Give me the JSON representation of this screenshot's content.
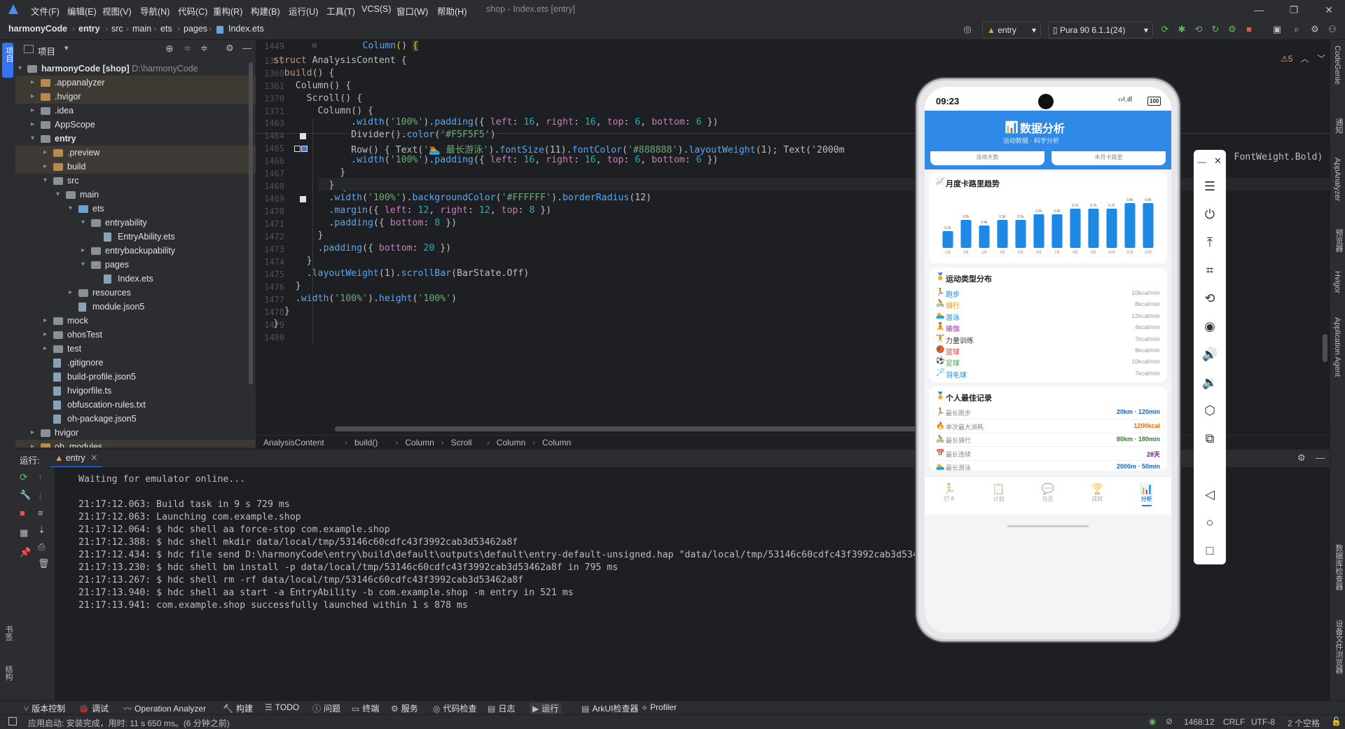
{
  "menu": [
    "文件(F)",
    "编辑(E)",
    "视图(V)",
    "导航(N)",
    "代码(C)",
    "重构(R)",
    "构建(B)",
    "运行(U)",
    "工具(T)",
    "VCS(S)",
    "窗口(W)",
    "帮助(H)"
  ],
  "window_title": "shop - Index.ets [entry]",
  "breadcrumbs": [
    "harmonyCode",
    "entry",
    "src",
    "main",
    "ets",
    "pages",
    "Index.ets"
  ],
  "toolbar": {
    "run_config": "entry",
    "device": "Pura 90 6.1.1(24)"
  },
  "project_panel": {
    "title": "项目",
    "root": {
      "name": "harmonyCode [shop]",
      "path": "D:\\harmonyCode"
    },
    "items": [
      {
        "name": ".appanalyzer",
        "indent": 1,
        "arrow": "▸",
        "icon": "folder-orange",
        "sel": true
      },
      {
        "name": ".hvigor",
        "indent": 1,
        "arrow": "▸",
        "icon": "folder-orange",
        "sel": true
      },
      {
        "name": ".idea",
        "indent": 1,
        "arrow": "▸",
        "icon": "folder"
      },
      {
        "name": "AppScope",
        "indent": 1,
        "arrow": "▸",
        "icon": "folder"
      },
      {
        "name": "entry",
        "indent": 1,
        "arrow": "▾",
        "icon": "folder",
        "bold": true
      },
      {
        "name": ".preview",
        "indent": 2,
        "arrow": "▸",
        "icon": "folder-orange",
        "sel": true
      },
      {
        "name": "build",
        "indent": 2,
        "arrow": "▸",
        "icon": "folder-orange",
        "sel": true
      },
      {
        "name": "src",
        "indent": 2,
        "arrow": "▾",
        "icon": "folder"
      },
      {
        "name": "main",
        "indent": 3,
        "arrow": "▾",
        "icon": "folder"
      },
      {
        "name": "ets",
        "indent": 4,
        "arrow": "▾",
        "icon": "folder-blue"
      },
      {
        "name": "entryability",
        "indent": 5,
        "arrow": "▾",
        "icon": "folder"
      },
      {
        "name": "EntryAbility.ets",
        "indent": 6,
        "arrow": "",
        "icon": "file"
      },
      {
        "name": "entrybackupability",
        "indent": 5,
        "arrow": "▸",
        "icon": "folder"
      },
      {
        "name": "pages",
        "indent": 5,
        "arrow": "▾",
        "icon": "folder"
      },
      {
        "name": "Index.ets",
        "indent": 6,
        "arrow": "",
        "icon": "file"
      },
      {
        "name": "resources",
        "indent": 4,
        "arrow": "▸",
        "icon": "folder"
      },
      {
        "name": "module.json5",
        "indent": 4,
        "arrow": "",
        "icon": "file"
      },
      {
        "name": "mock",
        "indent": 2,
        "arrow": "▸",
        "icon": "folder"
      },
      {
        "name": "ohosTest",
        "indent": 2,
        "arrow": "▸",
        "icon": "folder"
      },
      {
        "name": "test",
        "indent": 2,
        "arrow": "▸",
        "icon": "folder"
      },
      {
        "name": ".gitignore",
        "indent": 2,
        "arrow": "",
        "icon": "file"
      },
      {
        "name": "build-profile.json5",
        "indent": 2,
        "arrow": "",
        "icon": "file"
      },
      {
        "name": "hvigorfile.ts",
        "indent": 2,
        "arrow": "",
        "icon": "file"
      },
      {
        "name": "obfuscation-rules.txt",
        "indent": 2,
        "arrow": "",
        "icon": "file"
      },
      {
        "name": "oh-package.json5",
        "indent": 2,
        "arrow": "",
        "icon": "file"
      },
      {
        "name": "hvigor",
        "indent": 1,
        "arrow": "▸",
        "icon": "folder"
      },
      {
        "name": "oh_modules",
        "indent": 1,
        "arrow": "▸",
        "icon": "folder-orange",
        "sel": true
      }
    ]
  },
  "editor": {
    "sticky": [
      {
        "n": "1449",
        "t": "Column() {"
      },
      {
        "n": "1359",
        "t": "struct AnalysisContent {"
      },
      {
        "n": "1360",
        "t": "  build() {"
      },
      {
        "n": "1361",
        "t": "    Column() {"
      },
      {
        "n": "1370",
        "t": "      Scroll() {"
      },
      {
        "n": "1371",
        "t": "        Column() {"
      }
    ],
    "lines": [
      {
        "n": "1463",
        "t": "              .width('100%').padding({ left: 16, right: 16, top: 6, bottom: 6 })"
      },
      {
        "n": "1464",
        "t": "              Divider().color('#F5F5F5')"
      },
      {
        "n": "1465",
        "t": "              Row() { Text('🏊 最长游泳').fontSize(11).fontColor('#888888').layoutWeight(1); Text('2000m"
      },
      {
        "n": "1466",
        "t": "              .width('100%').padding({ left: 16, right: 16, top: 6, bottom: 6 })"
      },
      {
        "n": "1467",
        "t": "            }"
      },
      {
        "n": "1468",
        "t": "          }"
      },
      {
        "n": "1469",
        "t": "          .width('100%').backgroundColor('#FFFFFF').borderRadius(12)"
      },
      {
        "n": "1470",
        "t": "          .margin({ left: 12, right: 12, top: 8 })"
      },
      {
        "n": "1471",
        "t": "          .padding({ bottom: 8 })"
      },
      {
        "n": "1472",
        "t": "        }"
      },
      {
        "n": "1473",
        "t": "        .padding({ bottom: 20 })"
      },
      {
        "n": "1474",
        "t": "      }"
      },
      {
        "n": "1475",
        "t": "      .layoutWeight(1).scrollBar(BarState.Off)"
      },
      {
        "n": "1476",
        "t": "    }"
      },
      {
        "n": "1477",
        "t": "    .width('100%').height('100%')"
      },
      {
        "n": "1478",
        "t": "  }"
      },
      {
        "n": "1479",
        "t": "}"
      },
      {
        "n": "1480",
        "t": ""
      }
    ],
    "overflow_right": "tW    FontWeight.Bold) }",
    "warnings": "⚠5",
    "crumbs": [
      "AnalysisContent",
      "build()",
      "Column",
      "Scroll",
      "Column",
      "Column"
    ]
  },
  "run": {
    "label": "运行:",
    "tab": "entry",
    "log": [
      "Waiting for emulator online...",
      "",
      "21:17:12.063: Build task in 9 s 729 ms",
      "21:17:12.063: Launching com.example.shop",
      "21:17:12.064: $ hdc shell aa force-stop com.example.shop",
      "21:17:12.388: $ hdc shell mkdir data/local/tmp/53146c60cdfc43f3992cab3d53462a8f",
      "21:17:12.434: $ hdc file send D:\\harmonyCode\\entry\\build\\default\\outputs\\default\\entry-default-unsigned.hap \"data/local/tmp/53146c60cdfc43f3992cab3d5346",
      "21:17:13.230: $ hdc shell bm install -p data/local/tmp/53146c60cdfc43f3992cab3d53462a8f in 795 ms",
      "21:17:13.267: $ hdc shell rm -rf data/local/tmp/53146c60cdfc43f3992cab3d53462a8f",
      "21:17:13.940: $ hdc shell aa start -a EntryAbility -b com.example.shop -m entry in 521 ms",
      "21:17:13.941: com.example.shop successfully launched within 1 s 878 ms"
    ]
  },
  "bottom_tools": [
    "版本控制",
    "调试",
    "Operation Analyzer",
    "构建",
    "TODO",
    "问题",
    "终端",
    "服务",
    "代码检查",
    "日志",
    "运行",
    "ArkUI检查器",
    "Profiler"
  ],
  "status": {
    "message": "应用启动: 安装完成，用时: 11 s 650 ms。(6 分钟之前)",
    "position": "1468:12",
    "line_sep": "CRLF",
    "encoding": "UTF-8",
    "indent": "2 个空格"
  },
  "right_stripe": [
    "CodeGenie",
    "通知",
    "AppAnalyzer",
    "预览器",
    "Hvigor",
    "Application Agent",
    "数据库检查器",
    "设备文件浏览器"
  ],
  "left_stripe": [
    "项目",
    "书签",
    "结构"
  ],
  "phone": {
    "time": "09:23",
    "battery": "100",
    "header": {
      "title": "数据分析",
      "subtitle": "运动数据 · 科学分析"
    },
    "stat_labels": [
      "连续天数",
      "本月卡路里"
    ],
    "trend": {
      "title": "月度卡路里趋势"
    },
    "types": {
      "title": "运动类型分布",
      "items": [
        {
          "icon": "🏃",
          "name": "跑步",
          "val": "10kcal/min",
          "color": "#1e88e5"
        },
        {
          "icon": "🚴",
          "name": "骑行",
          "val": "8kcal/min",
          "color": "#fb8c00"
        },
        {
          "icon": "🏊",
          "name": "游泳",
          "val": "12kcal/min",
          "color": "#1e88e5"
        },
        {
          "icon": "🧘",
          "name": "瑜伽",
          "val": "4kcal/min",
          "color": "#8e24aa"
        },
        {
          "icon": "🏋",
          "name": "力量训练",
          "val": "7kcal/min",
          "color": "#333333"
        },
        {
          "icon": "🏀",
          "name": "篮球",
          "val": "9kcal/min",
          "color": "#e53935"
        },
        {
          "icon": "⚽",
          "name": "足球",
          "val": "10kcal/min",
          "color": "#43a047"
        },
        {
          "icon": "🏸",
          "name": "羽毛球",
          "val": "7kcal/min",
          "color": "#1e88e5"
        }
      ]
    },
    "records": {
      "title": "个人最佳记录",
      "items": [
        {
          "icon": "🏃",
          "name": "最长跑步",
          "val": "20km · 120min",
          "color": "#1565c0"
        },
        {
          "icon": "🔥",
          "name": "单次最大消耗",
          "val": "1200kcal",
          "color": "#ef6c00"
        },
        {
          "icon": "🚴",
          "name": "最长骑行",
          "val": "80km · 180min",
          "color": "#2e7d32"
        },
        {
          "icon": "📅",
          "name": "最长连续",
          "val": "28天",
          "color": "#6a1b9a"
        },
        {
          "icon": "🏊",
          "name": "最长游泳",
          "val": "2000m · 50min",
          "color": "#1565c0"
        }
      ]
    },
    "tabs": [
      {
        "icon": "🏃",
        "label": "打卡"
      },
      {
        "icon": "📋",
        "label": "计划"
      },
      {
        "icon": "💬",
        "label": "社区"
      },
      {
        "icon": "🏆",
        "label": "成就"
      },
      {
        "icon": "📊",
        "label": "分析",
        "active": true
      }
    ]
  },
  "chart_data": {
    "type": "bar",
    "title": "月度卡路里趋势",
    "categories": [
      "1月",
      "2月",
      "3月",
      "4月",
      "5月",
      "6月",
      "7月",
      "8月",
      "9月",
      "10月",
      "11月",
      "12月"
    ],
    "values": [
      0.3,
      0.5,
      0.4,
      0.5,
      0.5,
      0.6,
      0.6,
      0.7,
      0.7,
      0.7,
      0.8,
      0.8
    ],
    "labels": [
      "0.3k",
      "0.5k",
      "0.4k",
      "0.5k",
      "0.5k",
      "0.6k",
      "0.6k",
      "0.7k",
      "0.7k",
      "0.7k",
      "0.8k",
      "0.8k"
    ],
    "ylim": [
      0,
      0.9
    ],
    "bar_color": "#1e88e5"
  },
  "colors": {
    "accent": "#1e88e5",
    "editor_bg": "#1e1f22",
    "panel_bg": "#2b2d30"
  }
}
